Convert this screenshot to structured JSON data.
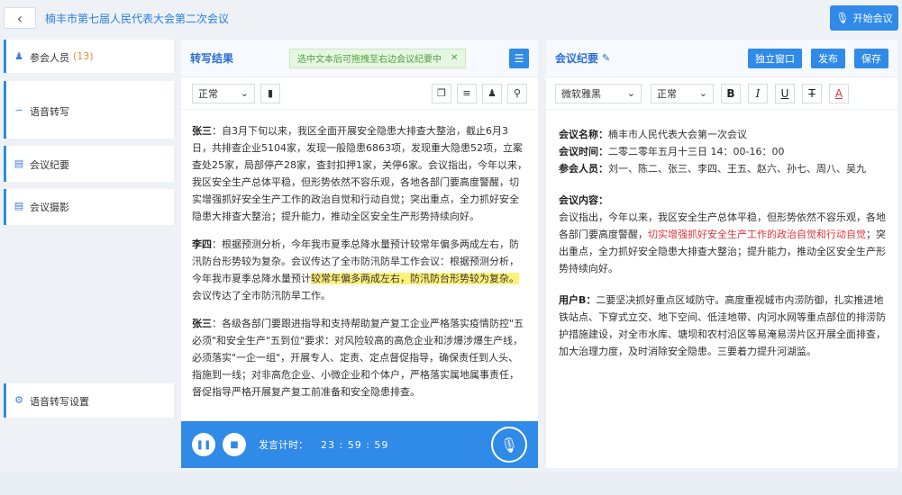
{
  "header": {
    "back_icon": "chevron-left-icon",
    "title": "楠丰市第七届人民代表大会第二次会议",
    "start_button": "开始会议"
  },
  "sidebar": {
    "participants_label": "参会人员",
    "participants_count": "(13)",
    "speech_transcribe": "语音转写",
    "meeting_minutes": "会议纪要",
    "meeting_summary": "会议摄影",
    "speech_settings": "语音转写设置"
  },
  "transcription": {
    "title": "转写结果",
    "hint": "选中文本后可拖拽至右边会议纪要中",
    "hint_close": "✕",
    "select_style": "正常",
    "paragraphs": [
      {
        "speaker": "张三",
        "text": "：自3月下旬以来，我区全面开展安全隐患大排查大整治，截止6月3日，共排查企业5104家，发现一般隐患6863项，发现重大隐患52项，立案查处25家，局部停产28家，查封扣押1家，关停6家。会议指出，今年以来，我区安全生产总体平稳，但形势依然不容乐观，各地各部门要高度警醒，切实增强抓好安全生产工作的政治自觉和行动自觉；突出重点，全力抓好安全隐患大排查大整治；提升能力，推动全区安全生产形势持续向好。",
        "pre": "",
        "highlight": "",
        "post": ""
      },
      {
        "speaker": "李四",
        "pre": "：根据预测分析，今年我市夏季总降水量预计较常年偏多两成左右，防汛防台形势较为复杂。会议传达了全市防汛防旱工作会议：根据预测分析，今年我市夏季总降水量预计",
        "highlight": "较常年偏多两成左右，防汛防台形势较为复杂。",
        "post": "会议传达了全市防汛防旱工作。"
      },
      {
        "speaker": "张三",
        "pre": "：各级各部门要跟进指导和支持帮助复产复工企业严格落实疫情防控\"五必须\"和安全生产\"五到位\"要求：对风险较高的高危企业和涉爆涉爆生产线，必须落实\"一企一组\"，开展专人、定责、定点督促指导，确保责任到人头、指施到一线；对非高危企业、小微企业和个体户，严格落实属地属事责任，督促指导严格开展复产复工前准备和安全隐患排查。",
        "highlight": "",
        "post": ""
      }
    ],
    "footer": {
      "pause_icon": "pause-icon",
      "stop_icon": "stop-icon",
      "timer_label": "发言计时：",
      "timer_value": "23 : 59 : 59",
      "mic_icon": "microphone-icon"
    }
  },
  "minutes": {
    "title": "会议纪要",
    "independent_window": "独立窗口",
    "publish": "发布",
    "save": "保存",
    "font_select": "微软雅黑",
    "style_select": "正常",
    "name_label": "会议名称：",
    "name_value": "楠丰市人民代表大会第一次会议",
    "time_label": "会议时间：",
    "time_value": "二零二零年五月十三日 14：00-16：00",
    "people_label": "参会人员：",
    "people_value": "刘一、陈二、张三、李四、王五、赵六、孙七、周八、吴九",
    "content_label": "会议内容：",
    "content_pre": "会议指出，今年以来，我区安全生产总体平稳，但形势依然不容乐观，各地各部门要高度警醒，",
    "content_red": "切实增强抓好安全生产工作的政治自觉和行动自觉",
    "content_post": "；突出重点，全力抓好安全隐患大排查大整治；提升能力，推动全区安全生产形势持续向好。",
    "user_label": "用户B：",
    "user_text": "二要坚决抓好重点区域防守。高度重视城市内涝防御，扎实推进地铁站点、下穿式立交、地下空间、低洼地带、内河水网等重点部位的排涝防护措施建设，对全市水库、塘坝和农村沿区等易淹易涝片区开展全面排查，加大治理力度，及时消除安全隐患。三要着力提升河湖监。"
  },
  "colors": {
    "primary": "#2f8ae8",
    "highlight": "#fff27a",
    "red_text": "#e0353b",
    "hint_green": "#4aa33a",
    "count_orange": "#e8903a"
  }
}
